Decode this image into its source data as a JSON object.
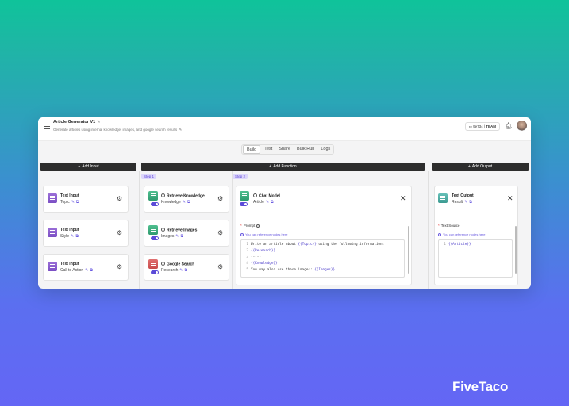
{
  "header": {
    "title": "Article Generator V1",
    "subtitle": "Generate articles using internal knowledge, images, and google search results",
    "credits_value": "9e734",
    "credits_label": "TEAM"
  },
  "tabs": [
    {
      "label": "Build",
      "active": true
    },
    {
      "label": "Test"
    },
    {
      "label": "Share"
    },
    {
      "label": "Bulk Run"
    },
    {
      "label": "Logs"
    }
  ],
  "columns": {
    "input": {
      "add_label": "Add Input"
    },
    "function": {
      "add_label": "Add Function"
    },
    "output": {
      "add_label": "Add Output"
    }
  },
  "steps": [
    "Step 1",
    "Step 2"
  ],
  "inputs": [
    {
      "title": "Text Input",
      "var": "Topic"
    },
    {
      "title": "Text Input",
      "var": "Style"
    },
    {
      "title": "Text Input",
      "var": "Call to Action"
    }
  ],
  "step1_nodes": [
    {
      "title": "Retrieve Knowledge",
      "var": "Knowledge"
    },
    {
      "title": "Retrieve Images",
      "var": "Images"
    },
    {
      "title": "Google Search",
      "var": "Research"
    }
  ],
  "chat_model": {
    "title": "Chat Model",
    "var": "Article",
    "prompt_label": "Prompt",
    "hint": "You can reference nodes here",
    "lines": [
      {
        "n": "1",
        "pre": "Write an article about ",
        "tpl": "{{Topic}}",
        "post": " using the following information:"
      },
      {
        "n": "2",
        "pre": "",
        "tpl": "{{Research}}",
        "post": ""
      },
      {
        "n": "3",
        "pre": "-----",
        "tpl": "",
        "post": ""
      },
      {
        "n": "4",
        "pre": "",
        "tpl": "{{Knowledge}}",
        "post": ""
      },
      {
        "n": "5",
        "pre": "You may also use these images: ",
        "tpl": "{{Images}}",
        "post": ""
      }
    ]
  },
  "output": {
    "title": "Text Output",
    "var": "Result",
    "source_label": "Text Source",
    "hint": "You can reference nodes here",
    "line_n": "1",
    "line_tpl": "{{Article}}"
  },
  "brand": "FiveTaco",
  "colors": {
    "accent": "#5b4bd8",
    "header_bar": "#2d2d2d"
  }
}
